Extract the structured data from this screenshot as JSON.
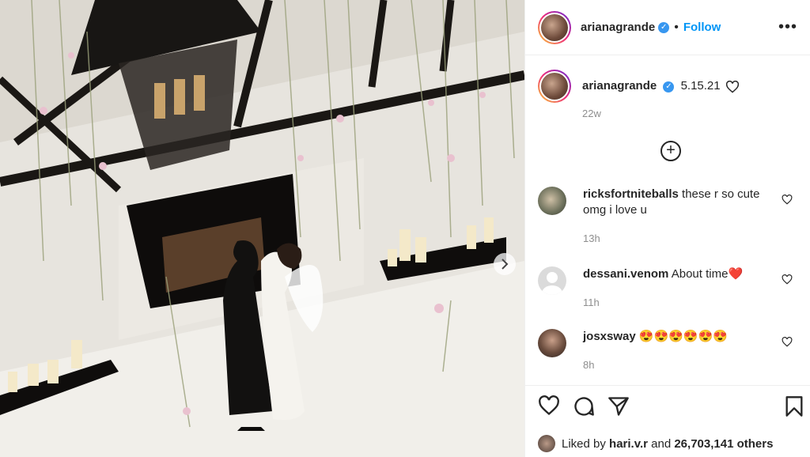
{
  "post": {
    "username": "ariana grande",
    "follow_label": "Follow",
    "more_label": "•••",
    "caption_username": "arianagrande",
    "caption_text": "5.15.21",
    "caption_time": "22w",
    "load_more_icon": "plus-circle-icon"
  },
  "header": {
    "username": "arianagrande",
    "separator": "•"
  },
  "comments": [
    {
      "username": "ricksfortniteballs",
      "text": "these r so cute omg i love u",
      "time": "13h"
    },
    {
      "username": "dessani.venom",
      "text": "About time❤️",
      "time": "11h"
    },
    {
      "username": "josxsway",
      "text": "😍😍😍😍😍😍",
      "time": "8h"
    }
  ],
  "likes": {
    "prefix": "Liked by",
    "user": "hari.v.r",
    "and": "and",
    "count": "26,703,141 others"
  },
  "icons": {
    "like": "heart-icon",
    "comment": "comment-icon",
    "share": "send-icon",
    "save": "bookmark-icon",
    "next": "chevron-right-icon",
    "verified": "verified-badge-icon"
  },
  "colors": {
    "link": "#0095f6",
    "verified": "#3897f0",
    "muted": "#8e8e8e",
    "heart_red": "#ed4956"
  }
}
